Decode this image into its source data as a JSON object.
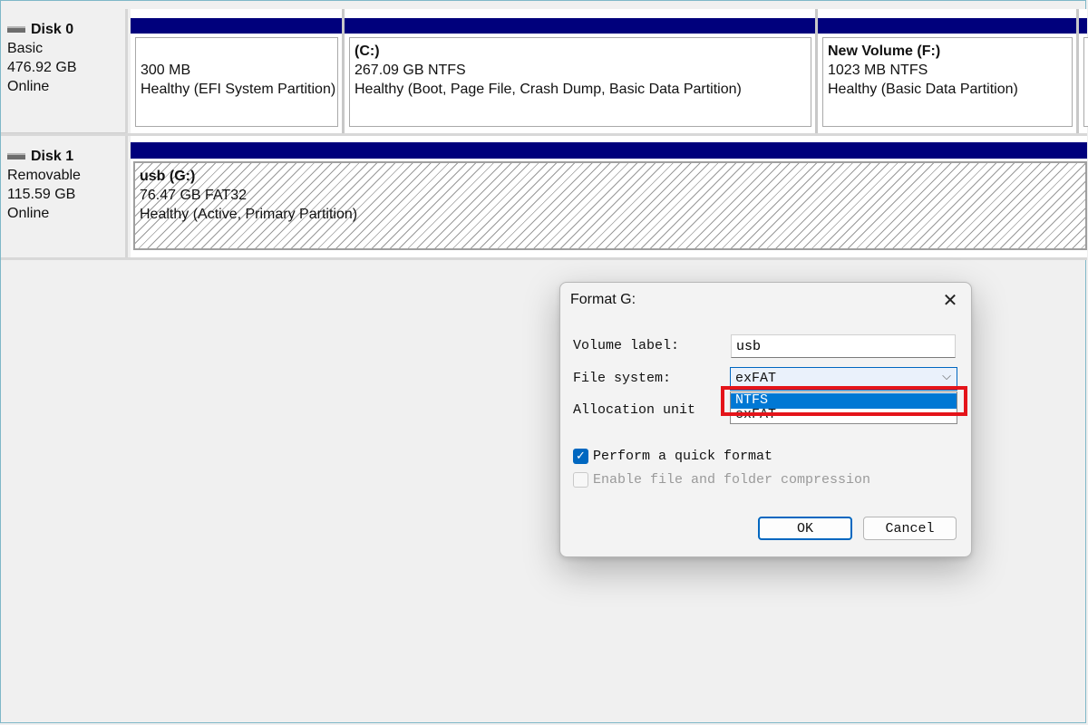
{
  "disks": [
    {
      "name": "Disk 0",
      "type": "Basic",
      "size": "476.92 GB",
      "status": "Online",
      "partitions": [
        {
          "title": "",
          "size_fs": "300 MB",
          "status": "Healthy (EFI System Partition)"
        },
        {
          "title": "(C:)",
          "size_fs": "267.09 GB NTFS",
          "status": "Healthy (Boot, Page File, Crash Dump, Basic Data Partition)"
        },
        {
          "title": "New Volume  (F:)",
          "size_fs": "1023 MB NTFS",
          "status": "Healthy (Basic Data Partition)"
        }
      ]
    },
    {
      "name": "Disk 1",
      "type": "Removable",
      "size": "115.59 GB",
      "status": "Online",
      "partitions": [
        {
          "title": "usb  (G:)",
          "size_fs": "76.47 GB FAT32",
          "status": "Healthy (Active, Primary Partition)"
        }
      ]
    }
  ],
  "dialog": {
    "title": "Format G:",
    "volume_label_label": "Volume label:",
    "volume_label_value": "usb",
    "file_system_label": "File system:",
    "file_system_value": "exFAT",
    "file_system_options": [
      "NTFS",
      "exFAT"
    ],
    "highlighted_option": "NTFS",
    "allocation_unit_label": "Allocation unit",
    "quick_format_label": "Perform a quick format",
    "quick_format_checked": true,
    "compression_label": "Enable file and folder compression",
    "compression_checked": false,
    "compression_enabled": false,
    "ok_label": "OK",
    "cancel_label": "Cancel"
  },
  "icons": {
    "disk": "disk-drive-icon",
    "close": "close-icon",
    "dropdown": "chevron-down-icon",
    "checkbox": "checkmark-icon"
  },
  "colors": {
    "partition_bar": "#00007c",
    "accent": "#0067c0",
    "selected_option": "#0078d4",
    "highlight_box": "#e4141a"
  }
}
